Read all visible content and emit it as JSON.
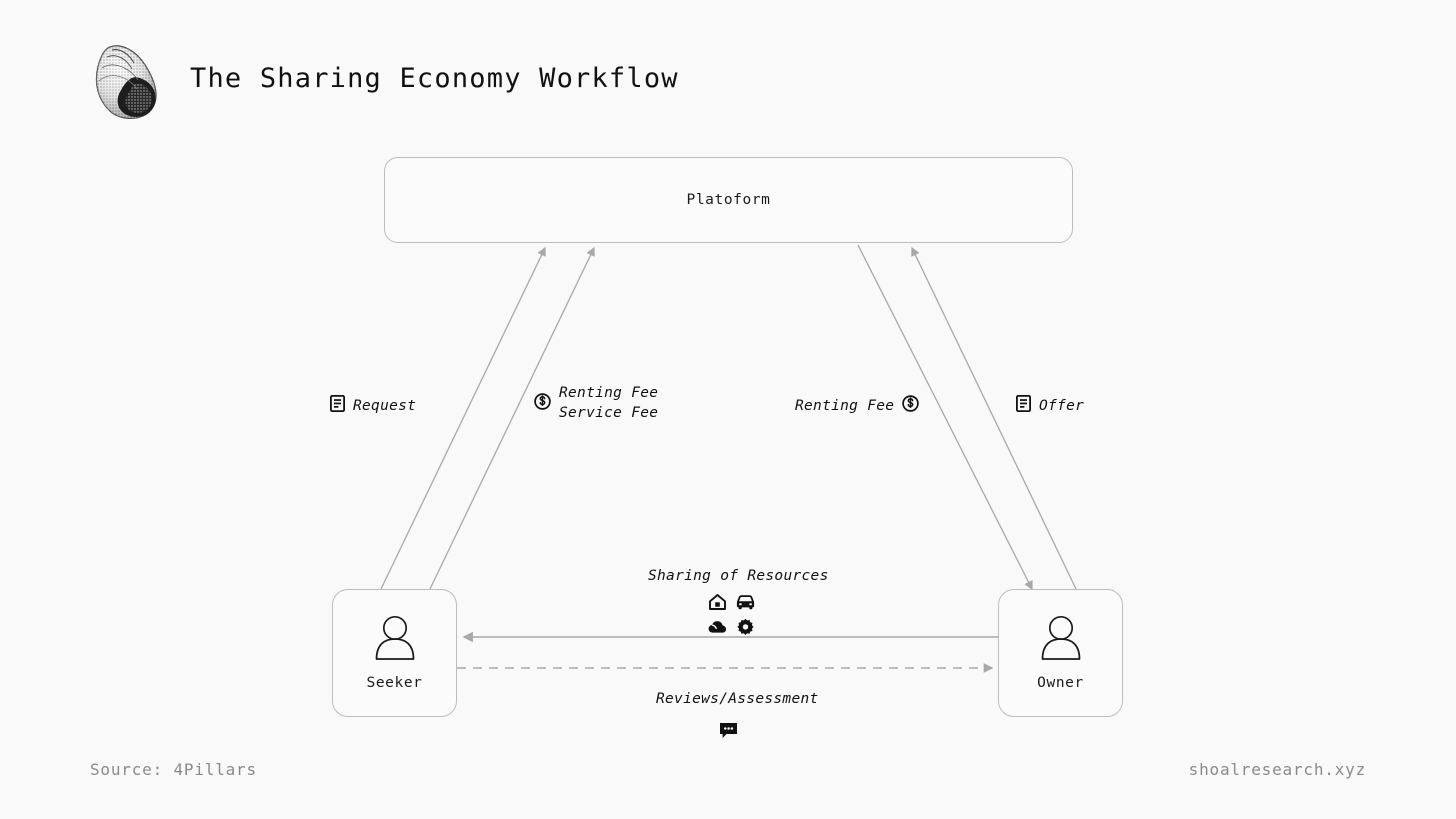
{
  "header": {
    "title": "The Sharing Economy Workflow",
    "logo_icon": "snail-shell-icon"
  },
  "diagram": {
    "nodes": {
      "platform": {
        "label": "Platoform"
      },
      "seeker": {
        "label": "Seeker",
        "icon": "person-icon"
      },
      "owner": {
        "label": "Owner",
        "icon": "person-icon"
      }
    },
    "edge_labels": {
      "request": {
        "text": "Request",
        "icon": "document-icon"
      },
      "fees": {
        "line1": "Renting Fee",
        "line2": "Service Fee",
        "icon": "dollar-coin-icon"
      },
      "renting": {
        "text": "Renting Fee",
        "icon": "dollar-coin-icon"
      },
      "offer": {
        "text": "Offer",
        "icon": "document-icon"
      },
      "sharing": {
        "text": "Sharing of Resources",
        "icons": [
          "house-icon",
          "car-icon",
          "cloud-icon",
          "gear-icon"
        ]
      },
      "reviews": {
        "text": "Reviews/Assessment",
        "icon": "speech-bubble-icon"
      }
    }
  },
  "footer": {
    "source": "Source: 4Pillars",
    "site": "shoalresearch.xyz"
  },
  "colors": {
    "background": "#f9f9f9",
    "node_border": "#bdbdbd",
    "link": "#a8a8a8",
    "text": "#111111",
    "muted_text": "#8a8a8a"
  }
}
